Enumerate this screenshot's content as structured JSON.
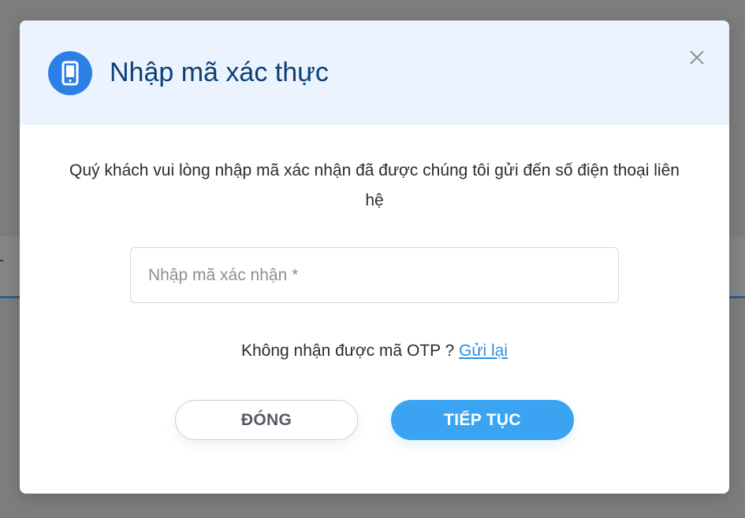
{
  "modal": {
    "title": "Nhập mã xác thực",
    "header_icon": "mobile-phone-icon",
    "close_icon": "close-icon",
    "description": "Quý khách vui lòng nhập mã xác nhận đã được chúng tôi gửi đến số điện thoại liên hệ",
    "otp_input": {
      "value": "",
      "placeholder": "Nhập mã xác nhận *"
    },
    "resend": {
      "prompt": "Không nhận được mã OTP ? ",
      "link_label": "Gửi lại"
    },
    "buttons": {
      "close_label": "ĐÓNG",
      "continue_label": "TIẾP TỤC"
    }
  },
  "colors": {
    "header_bg": "#ebf4fe",
    "title": "#0d3f77",
    "icon_bg": "#2d7fe6",
    "link": "#2a8ee6",
    "primary_button": "#3aa4f2",
    "overlay": "#7d7d7d"
  }
}
